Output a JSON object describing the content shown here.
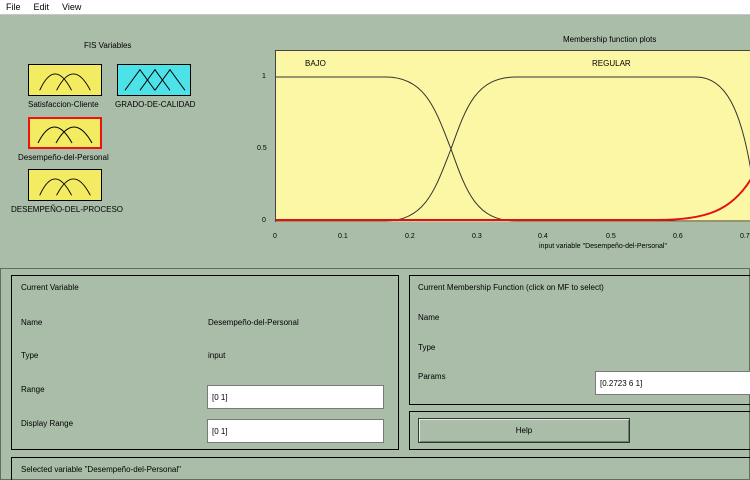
{
  "menu": [
    "File",
    "Edit",
    "View"
  ],
  "fis": {
    "title": "FIS Variables",
    "variables": [
      {
        "label": "Satisfaccion-Cliente",
        "color": "#f3ec62"
      },
      {
        "label": "GRADO-DE-CALIDAD",
        "color": "#4ce2e8"
      },
      {
        "label": "Desempeño-del-Personal",
        "color": "#f3ec62",
        "selected": true
      },
      {
        "label": "DESEMPEÑO-DEL-PROCESO",
        "color": "#f3ec62"
      }
    ]
  },
  "plot": {
    "title": "Membership function plots",
    "mf_labels": [
      "BAJO",
      "REGULAR"
    ],
    "y_ticks": [
      "1",
      "0.5",
      "0"
    ],
    "x_ticks": [
      "0",
      "0.1",
      "0.2",
      "0.3",
      "0.4",
      "0.5",
      "0.6",
      "0.7"
    ],
    "x_axis_title": "input variable \"Desempeño-del-Personal\"",
    "colors": {
      "plot_bg": "#fcf7a4",
      "mf_line": "#333333",
      "selected_mf": "#e11111"
    }
  },
  "current_variable": {
    "header": "Current Variable",
    "name_label": "Name",
    "name_value": "Desempeño-del-Personal",
    "type_label": "Type",
    "type_value": "input",
    "range_label": "Range",
    "range_value": "[0 1]",
    "display_range_label": "Display Range",
    "display_range_value": "[0 1]"
  },
  "current_mf": {
    "header": "Current Membership Function (click on MF to select)",
    "name_label": "Name",
    "type_label": "Type",
    "params_label": "Params",
    "params_value": "[0.2723 6 1]",
    "help_label": "Help"
  },
  "status": "Selected variable \"Desempeño-del-Personal\""
}
